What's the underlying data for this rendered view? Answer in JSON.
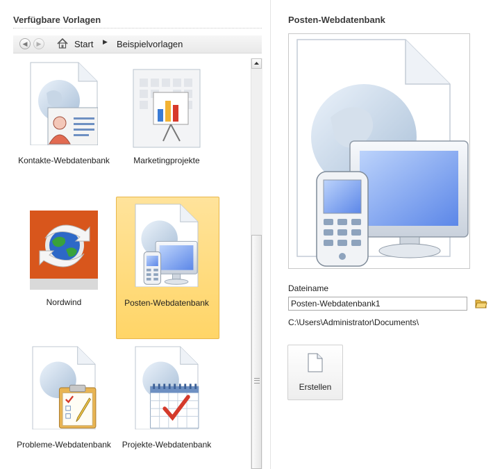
{
  "left_panel": {
    "title": "Verfügbare Vorlagen",
    "nav": {
      "back_icon": "back-arrow-icon",
      "forward_icon": "forward-arrow-icon",
      "home_icon": "home-icon",
      "crumbs": [
        "Start",
        "Beispielvorlagen"
      ]
    },
    "templates": [
      {
        "label": "Kontakte-Webdatenbank",
        "icon": "contacts-web-database-icon"
      },
      {
        "label": "Marketingprojekte",
        "icon": "marketing-projects-icon"
      },
      {
        "label": "Nordwind",
        "icon": "northwind-icon"
      },
      {
        "label": "Posten-Webdatenbank",
        "icon": "assets-web-database-icon",
        "selected": true
      },
      {
        "label": "Probleme-Webdatenbank",
        "icon": "issues-web-database-icon"
      },
      {
        "label": "Projekte-Webdatenbank",
        "icon": "projects-web-database-icon"
      }
    ]
  },
  "right_panel": {
    "title": "Posten-Webdatenbank",
    "filename_label": "Dateiname",
    "filename_value": "Posten-Webdatenbank1",
    "path": "C:\\Users\\Administrator\\Documents\\",
    "create_label": "Erstellen"
  },
  "colors": {
    "selection": "#ffd567",
    "selection_border": "#e8b64a"
  }
}
